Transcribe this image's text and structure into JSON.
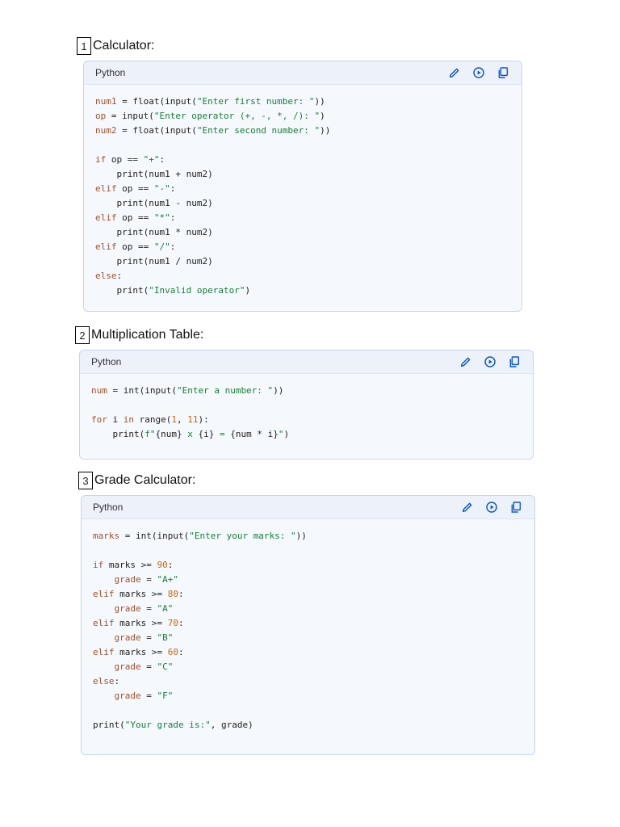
{
  "sections": [
    {
      "number": "1",
      "title": "Calculator:",
      "language": "Python",
      "lines": [
        [
          [
            "var",
            "num1"
          ],
          [
            "plain",
            " = float(input("
          ],
          [
            "str",
            "\"Enter first number: \""
          ],
          [
            "plain",
            "))"
          ]
        ],
        [
          [
            "var",
            "op"
          ],
          [
            "plain",
            " = input("
          ],
          [
            "str",
            "\"Enter operator (+, -, *, /): \""
          ],
          [
            "plain",
            ")"
          ]
        ],
        [
          [
            "var",
            "num2"
          ],
          [
            "plain",
            " = float(input("
          ],
          [
            "str",
            "\"Enter second number: \""
          ],
          [
            "plain",
            "))"
          ]
        ],
        [],
        [
          [
            "kw",
            "if"
          ],
          [
            "plain",
            " op == "
          ],
          [
            "str",
            "\"+\""
          ],
          [
            "plain",
            ":"
          ]
        ],
        [
          [
            "plain",
            "    print(num1 + num2)"
          ]
        ],
        [
          [
            "kw",
            "elif"
          ],
          [
            "plain",
            " op == "
          ],
          [
            "str",
            "\"-\""
          ],
          [
            "plain",
            ":"
          ]
        ],
        [
          [
            "plain",
            "    print(num1 - num2)"
          ]
        ],
        [
          [
            "kw",
            "elif"
          ],
          [
            "plain",
            " op == "
          ],
          [
            "str",
            "\"*\""
          ],
          [
            "plain",
            ":"
          ]
        ],
        [
          [
            "plain",
            "    print(num1 * num2)"
          ]
        ],
        [
          [
            "kw",
            "elif"
          ],
          [
            "plain",
            " op == "
          ],
          [
            "str",
            "\"/\""
          ],
          [
            "plain",
            ":"
          ]
        ],
        [
          [
            "plain",
            "    print(num1 / num2)"
          ]
        ],
        [
          [
            "kw",
            "else"
          ],
          [
            "plain",
            ":"
          ]
        ],
        [
          [
            "plain",
            "    print("
          ],
          [
            "str",
            "\"Invalid operator\""
          ],
          [
            "plain",
            ")"
          ]
        ]
      ]
    },
    {
      "number": "2",
      "title": "Multiplication Table:",
      "language": "Python",
      "lines": [
        [
          [
            "var",
            "num"
          ],
          [
            "plain",
            " = int(input("
          ],
          [
            "str",
            "\"Enter a number: \""
          ],
          [
            "plain",
            "))"
          ]
        ],
        [],
        [
          [
            "kw",
            "for"
          ],
          [
            "plain",
            " i "
          ],
          [
            "kw",
            "in"
          ],
          [
            "plain",
            " range("
          ],
          [
            "numlit",
            "1"
          ],
          [
            "plain",
            ", "
          ],
          [
            "numlit",
            "11"
          ],
          [
            "plain",
            "):"
          ]
        ],
        [
          [
            "plain",
            "    print("
          ],
          [
            "str",
            "f\""
          ],
          [
            "plain",
            "{num}"
          ],
          [
            "str",
            " x "
          ],
          [
            "plain",
            "{i}"
          ],
          [
            "str",
            " = "
          ],
          [
            "plain",
            "{num * i}"
          ],
          [
            "str",
            "\""
          ],
          [
            "plain",
            ")"
          ]
        ]
      ]
    },
    {
      "number": "3",
      "title": "Grade Calculator:",
      "language": "Python",
      "lines": [
        [
          [
            "var",
            "marks"
          ],
          [
            "plain",
            " = int(input("
          ],
          [
            "str",
            "\"Enter your marks: \""
          ],
          [
            "plain",
            "))"
          ]
        ],
        [],
        [
          [
            "kw",
            "if"
          ],
          [
            "plain",
            " marks >= "
          ],
          [
            "numlit",
            "90"
          ],
          [
            "plain",
            ":"
          ]
        ],
        [
          [
            "plain",
            "    "
          ],
          [
            "var",
            "grade"
          ],
          [
            "plain",
            " = "
          ],
          [
            "str",
            "\"A+\""
          ]
        ],
        [
          [
            "kw",
            "elif"
          ],
          [
            "plain",
            " marks >= "
          ],
          [
            "numlit",
            "80"
          ],
          [
            "plain",
            ":"
          ]
        ],
        [
          [
            "plain",
            "    "
          ],
          [
            "var",
            "grade"
          ],
          [
            "plain",
            " = "
          ],
          [
            "str",
            "\"A\""
          ]
        ],
        [
          [
            "kw",
            "elif"
          ],
          [
            "plain",
            " marks >= "
          ],
          [
            "numlit",
            "70"
          ],
          [
            "plain",
            ":"
          ]
        ],
        [
          [
            "plain",
            "    "
          ],
          [
            "var",
            "grade"
          ],
          [
            "plain",
            " = "
          ],
          [
            "str",
            "\"B\""
          ]
        ],
        [
          [
            "kw",
            "elif"
          ],
          [
            "plain",
            " marks >= "
          ],
          [
            "numlit",
            "60"
          ],
          [
            "plain",
            ":"
          ]
        ],
        [
          [
            "plain",
            "    "
          ],
          [
            "var",
            "grade"
          ],
          [
            "plain",
            " = "
          ],
          [
            "str",
            "\"C\""
          ]
        ],
        [
          [
            "kw",
            "else"
          ],
          [
            "plain",
            ":"
          ]
        ],
        [
          [
            "plain",
            "    "
          ],
          [
            "var",
            "grade"
          ],
          [
            "plain",
            " = "
          ],
          [
            "str",
            "\"F\""
          ]
        ],
        [],
        [
          [
            "plain",
            "print("
          ],
          [
            "str",
            "\"Your grade is:\""
          ],
          [
            "plain",
            ", grade)"
          ]
        ]
      ]
    }
  ],
  "toolbar": {
    "edit_icon": "pencil-icon",
    "run_icon": "play-circle-icon",
    "copy_icon": "copy-icon",
    "accent_color": "#0b57d0"
  }
}
